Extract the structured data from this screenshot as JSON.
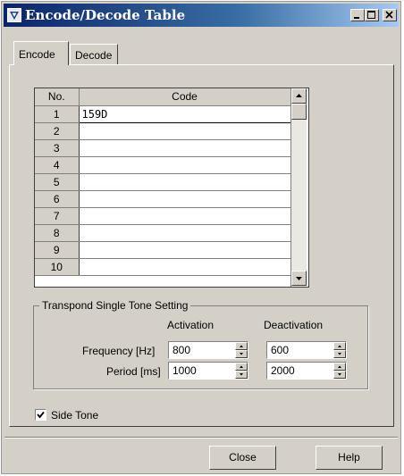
{
  "window": {
    "title": "Encode/Decode Table"
  },
  "tabs": [
    {
      "label": "Encode"
    },
    {
      "label": "Decode"
    }
  ],
  "table": {
    "col_no": "No.",
    "col_code": "Code",
    "rows": [
      {
        "no": "1",
        "code": "159D"
      },
      {
        "no": "2",
        "code": ""
      },
      {
        "no": "3",
        "code": ""
      },
      {
        "no": "4",
        "code": ""
      },
      {
        "no": "5",
        "code": ""
      },
      {
        "no": "6",
        "code": ""
      },
      {
        "no": "7",
        "code": ""
      },
      {
        "no": "8",
        "code": ""
      },
      {
        "no": "9",
        "code": ""
      },
      {
        "no": "10",
        "code": ""
      }
    ]
  },
  "transpond": {
    "legend": "Transpond Single Tone Setting",
    "activation_label": "Activation",
    "deactivation_label": "Deactivation",
    "frequency_label": "Frequency [Hz]",
    "period_label": "Period [ms]",
    "frequency_activation": "800",
    "frequency_deactivation": "600",
    "period_activation": "1000",
    "period_deactivation": "2000"
  },
  "side_tone": {
    "label": "Side Tone",
    "checked": true
  },
  "buttons": {
    "close": "Close",
    "help": "Help"
  }
}
